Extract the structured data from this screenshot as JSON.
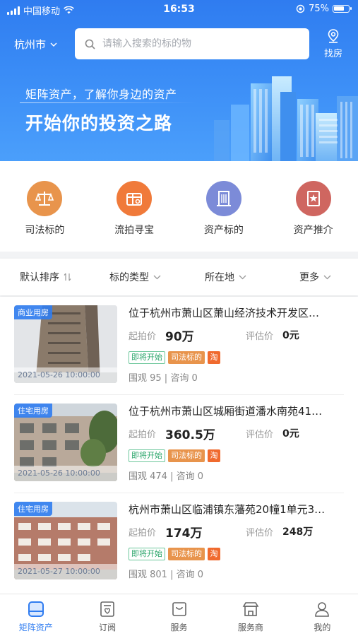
{
  "status_bar": {
    "carrier": "中国移动",
    "time": "16:53",
    "battery": "75%",
    "battery_level": 0.75
  },
  "header": {
    "city": "杭州市",
    "search_placeholder": "请输入搜索的标的物",
    "find_house_label": "找房",
    "slogan_small": "矩阵资产，了解你身边的资产",
    "slogan_big": "开始你的投资之路"
  },
  "categories": [
    {
      "label": "司法标的",
      "icon": "scales-icon",
      "color": "#e8944c"
    },
    {
      "label": "流拍寻宝",
      "icon": "treasure-box-icon",
      "color": "#f07a3a"
    },
    {
      "label": "资产标的",
      "icon": "building-icon",
      "color": "#7c8bd8"
    },
    {
      "label": "资产推介",
      "icon": "star-frame-icon",
      "color": "#cf6660"
    }
  ],
  "filters": [
    {
      "label": "默认排序",
      "icon": "sort-icon"
    },
    {
      "label": "标的类型",
      "icon": "chevron-down-icon"
    },
    {
      "label": "所在地",
      "icon": "chevron-down-icon"
    },
    {
      "label": "更多",
      "icon": "chevron-down-icon"
    }
  ],
  "listings": [
    {
      "type_tag": "商业用房",
      "date": "2021-05-26 10:00:00",
      "title": "位于杭州市萧山区萧山经济技术开发区…",
      "start_label": "起拍价",
      "start_price": "90万",
      "eval_label": "评估价",
      "eval_price": "0元",
      "badges": [
        "即将开始",
        "司法标的",
        "淘"
      ],
      "stats": "围观 95 | 咨询 0"
    },
    {
      "type_tag": "住宅用房",
      "date": "2021-05-26 10:00:00",
      "title": "位于杭州市萧山区城厢街道潘水南苑41…",
      "start_label": "起拍价",
      "start_price": "360.5万",
      "eval_label": "评估价",
      "eval_price": "0元",
      "badges": [
        "即将开始",
        "司法标的",
        "淘"
      ],
      "stats": "围观 474 | 咨询 0"
    },
    {
      "type_tag": "住宅用房",
      "date": "2021-05-27 10:00:00",
      "title": "杭州市萧山区临浦镇东藩苑20幢1单元3…",
      "start_label": "起拍价",
      "start_price": "174万",
      "eval_label": "评估价",
      "eval_price": "248万",
      "badges": [
        "即将开始",
        "司法标的",
        "淘"
      ],
      "stats": "围观 801 | 咨询 0"
    }
  ],
  "tabbar": [
    {
      "label": "矩阵资产",
      "icon": "home-asset-icon",
      "active": true
    },
    {
      "label": "订阅",
      "icon": "subscribe-heart-icon",
      "active": false
    },
    {
      "label": "服务",
      "icon": "bag-icon",
      "active": false
    },
    {
      "label": "服务商",
      "icon": "shop-icon",
      "active": false
    },
    {
      "label": "我的",
      "icon": "user-icon",
      "active": false
    }
  ],
  "colors": {
    "brand_blue": "#2f7cf0",
    "tag_green": "#2aa56a",
    "tag_orange": "#e8944c",
    "tao_orange": "#f06a2e"
  }
}
